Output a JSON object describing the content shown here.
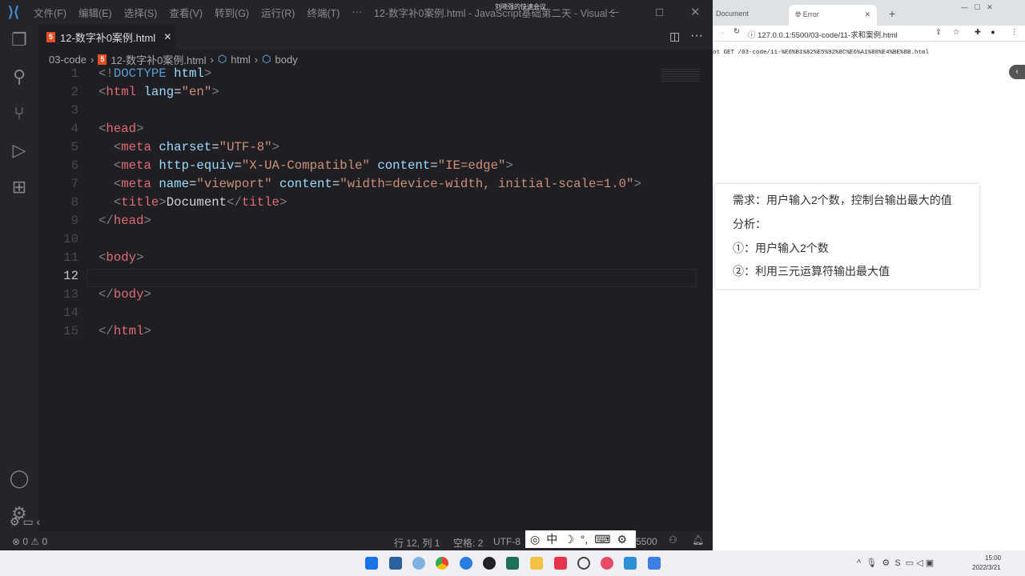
{
  "titlebar": {
    "menus": [
      "文件(F)",
      "编辑(E)",
      "选择(S)",
      "查看(V)",
      "转到(G)",
      "运行(R)",
      "终端(T)"
    ],
    "more": "···",
    "title": "12-数字补0案例.html - JavaScript基础第二天 - Visual Stu...",
    "meeting": "刘晓强的快速会议"
  },
  "tab": {
    "label": "12-数字补0案例.html",
    "close": "✕",
    "icon": "5"
  },
  "breadcrumb": [
    "03-code",
    "12-数字补0案例.html",
    "html",
    "body"
  ],
  "code": [
    [
      [
        "t-p",
        "<!"
      ],
      [
        "t-t",
        "DOCTYPE"
      ],
      [
        "t-x",
        " "
      ],
      [
        "t-a",
        "html"
      ],
      [
        "t-p",
        ">"
      ]
    ],
    [
      [
        "t-p",
        "<"
      ],
      [
        "t-tg",
        "html"
      ],
      [
        "t-x",
        " "
      ],
      [
        "t-a",
        "lang"
      ],
      [
        "t-x",
        "="
      ],
      [
        "t-s",
        "\"en\""
      ],
      [
        "t-p",
        ">"
      ]
    ],
    [],
    [
      [
        "t-p",
        "<"
      ],
      [
        "t-tg",
        "head"
      ],
      [
        "t-p",
        ">"
      ]
    ],
    [
      [
        "t-x",
        "  "
      ],
      [
        "t-p",
        "<"
      ],
      [
        "t-tg",
        "meta"
      ],
      [
        "t-x",
        " "
      ],
      [
        "t-a",
        "charset"
      ],
      [
        "t-x",
        "="
      ],
      [
        "t-s",
        "\"UTF-8\""
      ],
      [
        "t-p",
        ">"
      ]
    ],
    [
      [
        "t-x",
        "  "
      ],
      [
        "t-p",
        "<"
      ],
      [
        "t-tg",
        "meta"
      ],
      [
        "t-x",
        " "
      ],
      [
        "t-a",
        "http-equiv"
      ],
      [
        "t-x",
        "="
      ],
      [
        "t-s",
        "\"X-UA-Compatible\""
      ],
      [
        "t-x",
        " "
      ],
      [
        "t-a",
        "content"
      ],
      [
        "t-x",
        "="
      ],
      [
        "t-s",
        "\"IE=edge\""
      ],
      [
        "t-p",
        ">"
      ]
    ],
    [
      [
        "t-x",
        "  "
      ],
      [
        "t-p",
        "<"
      ],
      [
        "t-tg",
        "meta"
      ],
      [
        "t-x",
        " "
      ],
      [
        "t-a",
        "name"
      ],
      [
        "t-x",
        "="
      ],
      [
        "t-s",
        "\"viewport\""
      ],
      [
        "t-x",
        " "
      ],
      [
        "t-a",
        "content"
      ],
      [
        "t-x",
        "="
      ],
      [
        "t-s",
        "\"width=device-width, initial-scale=1.0\""
      ],
      [
        "t-p",
        ">"
      ]
    ],
    [
      [
        "t-x",
        "  "
      ],
      [
        "t-p",
        "<"
      ],
      [
        "t-tg",
        "title"
      ],
      [
        "t-p",
        ">"
      ],
      [
        "t-x",
        "Document"
      ],
      [
        "t-p",
        "</"
      ],
      [
        "t-tg",
        "title"
      ],
      [
        "t-p",
        ">"
      ]
    ],
    [
      [
        "t-p",
        "</"
      ],
      [
        "t-tg",
        "head"
      ],
      [
        "t-p",
        ">"
      ]
    ],
    [],
    [
      [
        "t-p",
        "<"
      ],
      [
        "t-tg",
        "body"
      ],
      [
        "t-p",
        ">"
      ]
    ],
    [],
    [
      [
        "t-p",
        "</"
      ],
      [
        "t-tg",
        "body"
      ],
      [
        "t-p",
        ">"
      ]
    ],
    [],
    [
      [
        "t-p",
        "</"
      ],
      [
        "t-tg",
        "html"
      ],
      [
        "t-p",
        ">"
      ]
    ]
  ],
  "current_line": 12,
  "status": {
    "errors": "0",
    "warnings": "0",
    "position": "行 12, 列 1",
    "spaces": "空格: 2",
    "encoding": "UTF-8",
    "port": "5500",
    "ime": [
      "中",
      "☽",
      "°,",
      "⌨",
      "⚙"
    ]
  },
  "browser": {
    "tabs": [
      "Document",
      "Error"
    ],
    "url": "127.0.0.1:5500/03-code/11-求和案例.html",
    "error": "ot GET /03-code/11-%E6%B1%82%E5%92%8C%E6%A1%88%E4%BE%8B.html"
  },
  "card": {
    "lines": [
      "需求：用户输入2个数，控制台输出最大的值",
      "分析：",
      "①：用户输入2个数",
      "②：利用三元运算符输出最大值"
    ]
  },
  "taskbar": {
    "time": "15:00",
    "date": "2022/3/21"
  }
}
